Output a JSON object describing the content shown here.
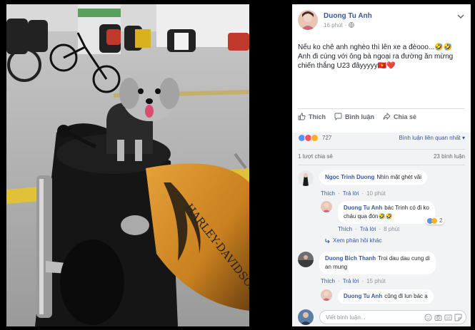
{
  "post": {
    "author": "Duong Tu Anh",
    "time": "16 phút",
    "privacy_icon": "globe-icon",
    "text_lines": [
      "Nếu ko chê anh nghèo thì lên xe a đèooo...🤣🤣",
      "Anh đi cùng với ông bà ngoại ra đường ăn mừng",
      "chiến thắng U23 đâyyyyy🇻🇳❤️"
    ]
  },
  "actions": {
    "like": "Thích",
    "comment": "Bình luận",
    "share": "Chia sẻ"
  },
  "reactions": {
    "count": "727",
    "sort_label": "Bình luận liên quan nhất"
  },
  "stats": {
    "shares": "1 lượt chia sẻ",
    "comments": "23 bình luận"
  },
  "comments": [
    {
      "name": "Ngọc Trinh Duong",
      "text": "Nhìn mặt ghét vãi",
      "like": "Thích",
      "reply": "Trả lời",
      "time": "10 phút"
    },
    {
      "name": "Duong Tu Anh",
      "text_line1": "bác Trinh có đi ko",
      "text_line2": "cháu qua đón🤣🤣",
      "like": "Thích",
      "reply": "Trả lời",
      "time": "8 phút",
      "reaction_count": "2"
    },
    {
      "name": "Duong Bich Thanh",
      "text_line1": "Troi dau dau cung di",
      "text_line2": "an mung",
      "like": "Thích",
      "reply": "Trả lời",
      "time": "15 phút"
    },
    {
      "name": "Duong Tu Anh",
      "text": "cũng đi lun bác ạ"
    }
  ],
  "view_more": "Xem phản hồi khác",
  "compose": {
    "placeholder": "Viết bình luận..."
  },
  "colors": {
    "link": "#365899",
    "meta": "#90949c",
    "like_blue": "#5890ff",
    "love_red": "#f25268",
    "haha_yellow": "#f7b125"
  }
}
